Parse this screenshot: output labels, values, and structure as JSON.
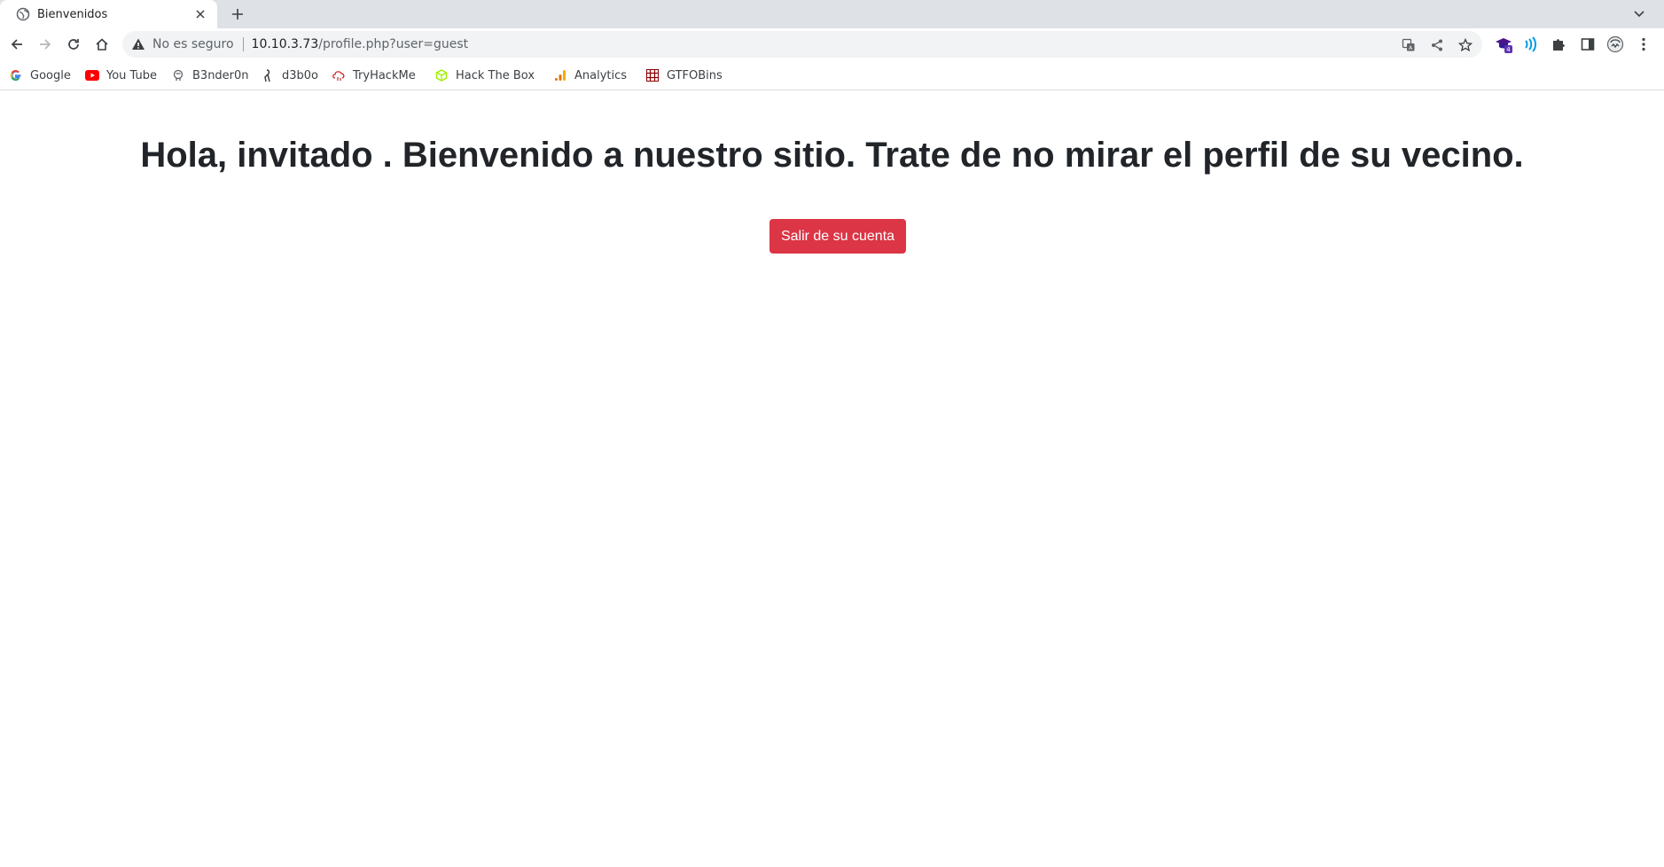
{
  "browser": {
    "tab": {
      "title": "Bienvenidos"
    },
    "omnibox": {
      "security_label": "No es seguro",
      "host": "10.10.3.73",
      "path": "/profile.php?user=guest"
    },
    "bookmarks": [
      {
        "label": "Google",
        "icon": "google-icon"
      },
      {
        "label": "You Tube",
        "icon": "youtube-icon"
      },
      {
        "label": "B3nder0n",
        "icon": "b3nder0n-icon"
      },
      {
        "label": "d3b0o",
        "icon": "d3b0o-icon"
      },
      {
        "label": "TryHackMe",
        "icon": "tryhackme-icon"
      },
      {
        "label": "Hack The Box",
        "icon": "hackthebox-icon"
      },
      {
        "label": "Analytics",
        "icon": "analytics-icon"
      },
      {
        "label": "GTFOBins",
        "icon": "gtfobins-icon"
      }
    ],
    "extension_badge": "4"
  },
  "page": {
    "greeting_prefix": "Hola, ",
    "username": "invitado",
    "greeting_suffix": " . Bienvenido a nuestro sitio. Trate de no mirar el perfil de su vecino.",
    "logout_label": "Salir de su cuenta"
  },
  "colors": {
    "danger": "#dc3545",
    "tabstrip": "#dee1e6",
    "omnibox": "#f1f3f4",
    "text": "#212529"
  }
}
